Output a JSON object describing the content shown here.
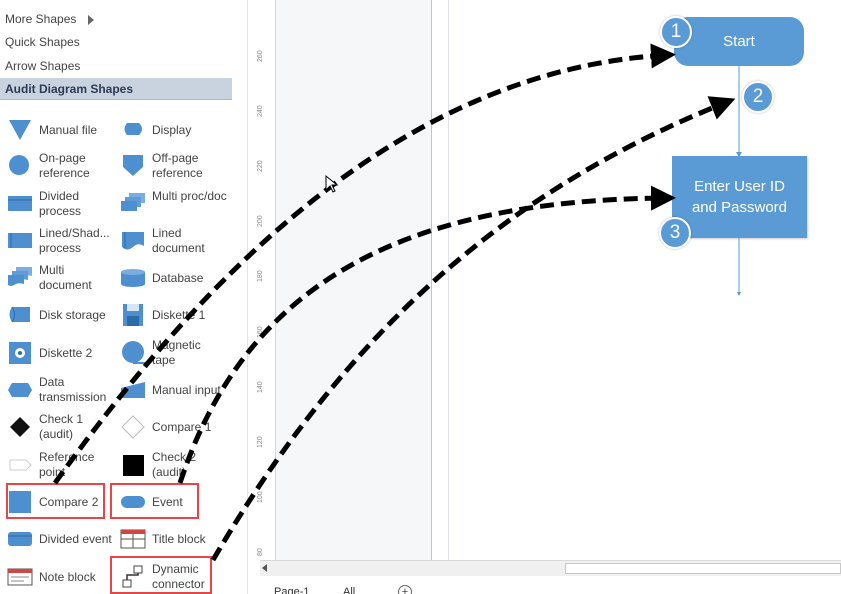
{
  "menu": {
    "more_shapes": "More Shapes",
    "quick_shapes": "Quick Shapes",
    "arrow_shapes": "Arrow Shapes",
    "audit_shapes": "Audit Diagram Shapes"
  },
  "shapes": {
    "manual_file": "Manual file",
    "display": "Display",
    "on_page_reference": "On-page reference",
    "off_page_reference": "Off-page reference",
    "divided_process": "Divided process",
    "multi_proc_doc": "Multi proc/doc",
    "lined_shaded_process": "Lined/Shad... process",
    "lined_document": "Lined document",
    "multi_document": "Multi document",
    "database": "Database",
    "disk_storage": "Disk storage",
    "diskette_1": "Diskette 1",
    "diskette_2": "Diskette 2",
    "magnetic_tape": "Magnetic tape",
    "data_transmission": "Data transmission",
    "manual_input": "Manual input",
    "check_1_audit": "Check 1 (audit)",
    "compare_1": "Compare 1",
    "reference_point": "Reference point",
    "check_2_audit": "Check 2 (audit)",
    "compare_2": "Compare 2",
    "event": "Event",
    "divided_event": "Divided event",
    "title_block": "Title block",
    "note_block": "Note block",
    "dynamic_connector": "Dynamic connector"
  },
  "ruler": {
    "labels": [
      "260",
      "240",
      "220",
      "200",
      "180",
      "160",
      "140",
      "120",
      "100",
      "80"
    ]
  },
  "flowchart": {
    "start_label": "Start",
    "process_label": "Enter User ID and Password",
    "badge_1": "1",
    "badge_2": "2",
    "badge_3": "3"
  },
  "tabs": {
    "page_1": "Page-1",
    "all": "All",
    "add_page": "+"
  },
  "colors": {
    "flow_fill": "#5b9bd5",
    "highlight_border": "#e8454b",
    "selected_category": "#c9d3e0"
  }
}
